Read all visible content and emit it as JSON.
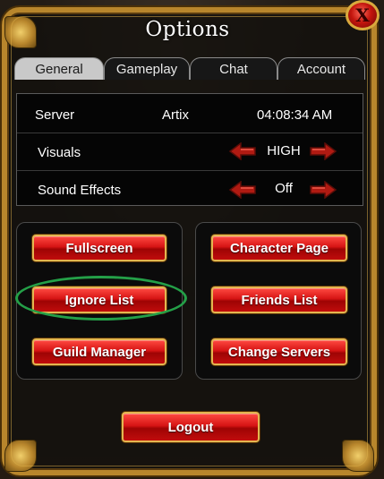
{
  "window": {
    "title": "Options",
    "close_label": "X"
  },
  "tabs": [
    {
      "label": "General",
      "active": true
    },
    {
      "label": "Gameplay",
      "active": false
    },
    {
      "label": "Chat",
      "active": false
    },
    {
      "label": "Account",
      "active": false
    }
  ],
  "settings": {
    "server": {
      "label": "Server",
      "name": "Artix",
      "time": "04:08:34 AM"
    },
    "visuals": {
      "label": "Visuals",
      "value": "HIGH"
    },
    "sound_effects": {
      "label": "Sound Effects",
      "value": "Off"
    }
  },
  "buttons_left": {
    "fullscreen": "Fullscreen",
    "ignore_list": "Ignore List",
    "guild_manager": "Guild Manager"
  },
  "buttons_right": {
    "character_page": "Character Page",
    "friends_list": "Friends List",
    "change_servers": "Change Servers"
  },
  "logout": "Logout",
  "colors": {
    "frame_gold": "#b8862c",
    "button_red": "#d61414",
    "button_border": "#e3b650",
    "highlight_green": "#24a048",
    "active_tab": "#c9c9c9"
  },
  "icons": {
    "close": "close-x-icon",
    "arrow_left": "left-arrow-icon",
    "arrow_right": "right-arrow-icon"
  }
}
